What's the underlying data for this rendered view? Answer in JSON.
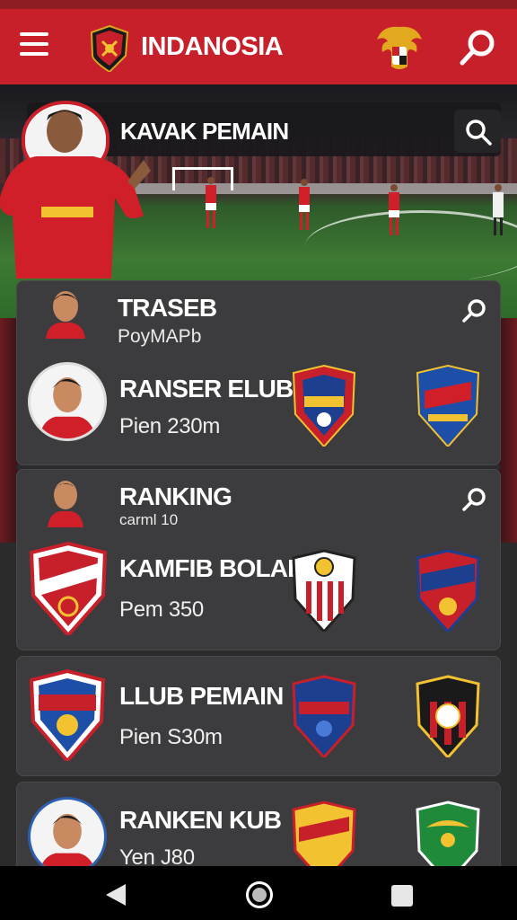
{
  "app_bar": {
    "title": "INDANOSIA",
    "menu_icon": "hamburger-menu-icon",
    "logo_icon": "club-shield-logo-icon",
    "emblem_icon": "garuda-emblem-icon",
    "search_icon": "search-icon",
    "color": "#c8202a"
  },
  "banner": {
    "title": "KAVAK PEMAIN",
    "search_icon": "search-icon"
  },
  "cards": [
    {
      "header": {
        "title": "TRASEB",
        "subtitle": "PoyMAPb"
      },
      "row": {
        "title": "RANSER ELUB",
        "subtitle": "Pien 230m"
      }
    },
    {
      "header": {
        "title": "RANKING",
        "subtitle": "carml 10"
      },
      "row": {
        "title": "KAMFIB BOLAB",
        "subtitle": "Pem 350"
      }
    },
    {
      "row": {
        "title": "LLUB PEMAIN",
        "subtitle": "Pien S30m"
      }
    },
    {
      "row": {
        "title": "RANKEN KUB",
        "subtitle": "Yen J80"
      }
    }
  ],
  "nav": {
    "back_icon": "back-triangle-icon",
    "home_icon": "home-circle-icon",
    "recent_icon": "recent-apps-square-icon"
  }
}
